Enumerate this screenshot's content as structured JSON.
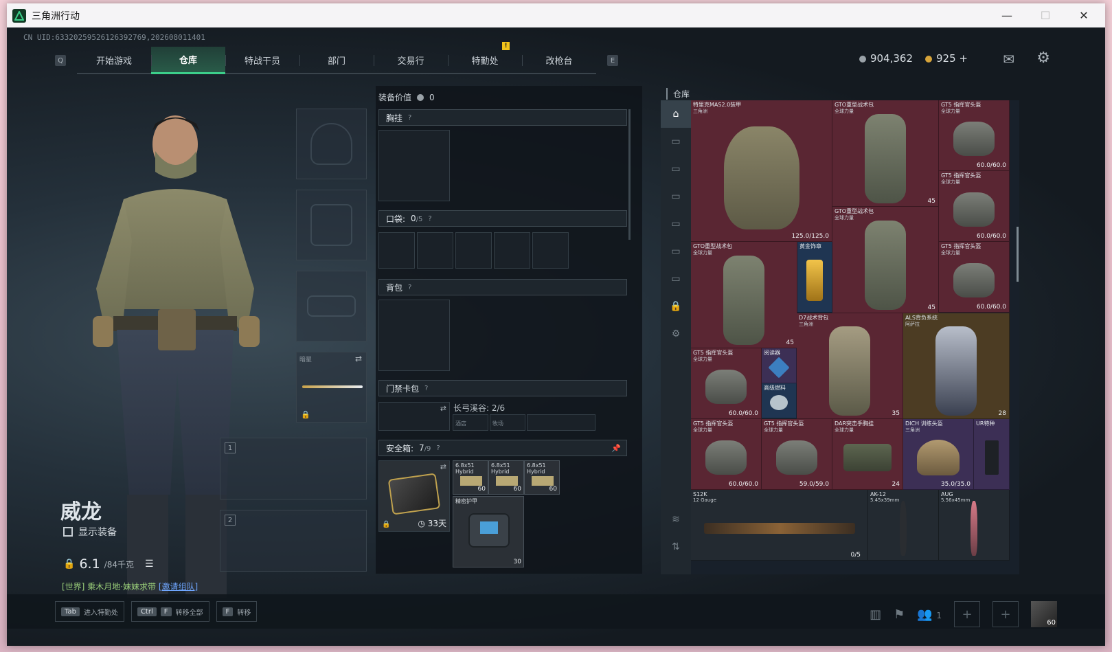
{
  "window": {
    "title": "三角洲行动",
    "minimize": "—",
    "maximize": "☐",
    "close": "✕"
  },
  "uid": "CN UID:633202595261263927​69,202608011401",
  "nav": {
    "left_key": "Q",
    "right_key": "E",
    "tabs": [
      "开始游戏",
      "仓库",
      "特战干员",
      "部门",
      "交易行",
      "特勤处",
      "改枪台"
    ],
    "active_tab": "仓库",
    "notice_badge": "!"
  },
  "currency": {
    "coins": "904,362",
    "bonds": "925",
    "add": "+"
  },
  "operator": {
    "name": "威龙",
    "show_gear_label": "显示装备",
    "weight": "6.1",
    "weight_max": "/84千克",
    "chat_prefix": "[世界]",
    "chat_text": "乘木月地·妹妹求带",
    "chat_invite": "[邀请组队]"
  },
  "slots": {
    "melee_label": "暗星",
    "weapon1_num": "1",
    "weapon2_num": "2"
  },
  "equip_panel": {
    "value_label": "装备价值",
    "value": "0",
    "chest_rig": "胸挂",
    "pockets": "口袋:",
    "pockets_count": "0",
    "pockets_max": "/5",
    "backpack": "背包",
    "keycard": "门禁卡包",
    "keycard_map": "长弓溪谷: 2/6",
    "keycard_items": [
      "酒店",
      "牧场"
    ],
    "safebox": "安全箱:",
    "safebox_count": "7",
    "safebox_max": "/9",
    "safebox_days": "33天",
    "q": "?"
  },
  "safebox_items": [
    {
      "name": "6.8x51 Hybrid",
      "count": "60"
    },
    {
      "name": "6.8x51 Hybrid",
      "count": "60"
    },
    {
      "name": "6.8x51 Hybrid",
      "count": "60"
    },
    {
      "name": "精密护甲",
      "count": "30"
    }
  ],
  "stash": {
    "title": "仓库",
    "top_labels": [
      "125.0/125.0",
      "125.0/125.0"
    ],
    "items": [
      {
        "name": "特里克MAS2.0装甲",
        "sub": "三角洲",
        "dur": "125.0/125.0"
      },
      {
        "name": "GTO重型战术包",
        "sub": "全球力量",
        "dur": "45"
      },
      {
        "name": "GT5 指挥官头盔",
        "sub": "全球力量",
        "dur": "60.0/60.0"
      },
      {
        "name": "GT5 指挥官头盔",
        "sub": "全球力量",
        "dur": "60.0/60.0"
      },
      {
        "name": "GTO重型战术包",
        "sub": "全球力量",
        "dur": "45"
      },
      {
        "name": "黄金饰章",
        "sub": "",
        "dur": ""
      },
      {
        "name": "GTO重型战术包",
        "sub": "全球力量",
        "dur": "45"
      },
      {
        "name": "GT5 指挥官头盔",
        "sub": "全球力量",
        "dur": "60.0/60.0"
      },
      {
        "name": "GT5 指挥官头盔",
        "sub": "全球力量",
        "dur": "60.0/60.0"
      },
      {
        "name": "阅读器",
        "sub": "",
        "dur": ""
      },
      {
        "name": "高级燃料",
        "sub": "",
        "dur": ""
      },
      {
        "name": "D7战术背包",
        "sub": "三角洲",
        "dur": "35"
      },
      {
        "name": "ALS背负系统",
        "sub": "阿萨拉",
        "dur": "28"
      },
      {
        "name": "GT5 指挥官头盔",
        "sub": "全球力量",
        "dur": "60.0/60.0"
      },
      {
        "name": "GT5 指挥官头盔",
        "sub": "全球力量",
        "dur": "59.0/59.0"
      },
      {
        "name": "DAR突击手胸挂",
        "sub": "全球力量",
        "dur": "24"
      },
      {
        "name": "DICH 训练头盔",
        "sub": "三角洲",
        "dur": "35.0/35.0"
      },
      {
        "name": "UR特种",
        "sub": "",
        "dur": ""
      },
      {
        "name": "S12K",
        "sub": "12 Gauge",
        "dur": "0/5"
      },
      {
        "name": "AK-12",
        "sub": "5.45x39mm",
        "dur": ""
      },
      {
        "name": "AUG",
        "sub": "5.56x45mm",
        "dur": ""
      }
    ]
  },
  "bottom": {
    "hints": [
      {
        "keys": [
          "Tab"
        ],
        "label": "进入特勤处"
      },
      {
        "keys": [
          "Ctrl",
          "F"
        ],
        "label": "转移全部"
      },
      {
        "keys": [
          "F"
        ],
        "label": "转移"
      }
    ],
    "squad_count": "1",
    "avatar_level": "60"
  },
  "colors": {
    "accent": "#3ccf8a",
    "rarity_red": "#5a2633",
    "rarity_gold": "#4c3c23",
    "rarity_purple": "#3c2f55",
    "rarity_blue": "#1f3552"
  }
}
